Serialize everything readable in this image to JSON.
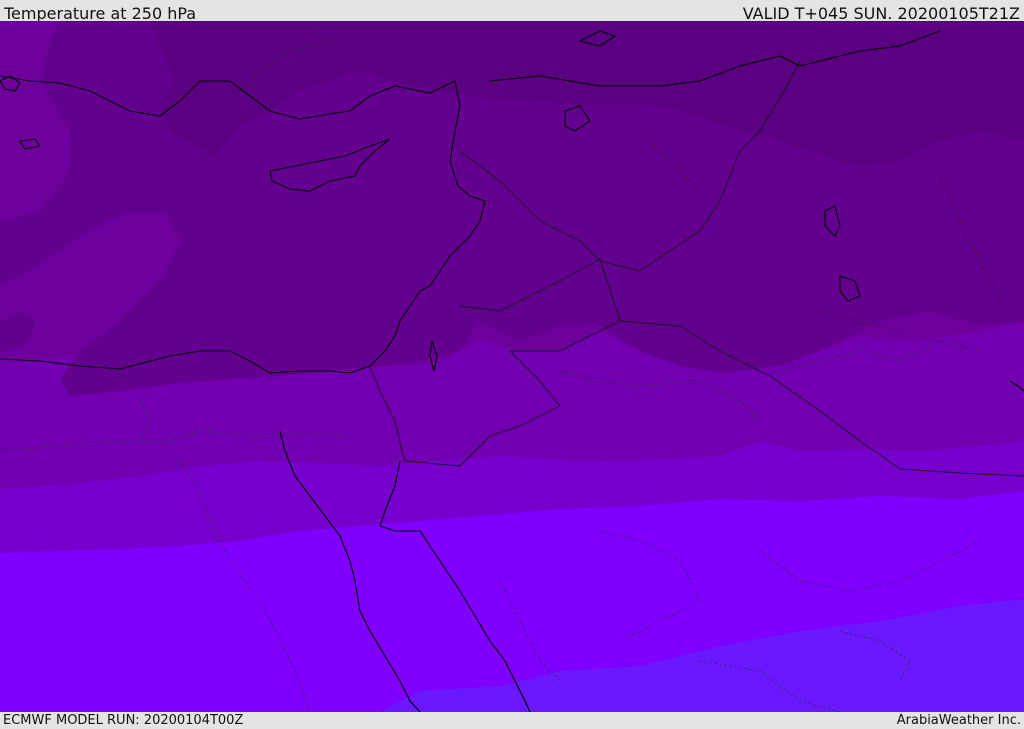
{
  "header": {
    "title": "Temperature at 250 hPa",
    "valid": "VALID T+045 SUN. 20200105T21Z"
  },
  "footer": {
    "model_run": "ECMWF MODEL RUN: 20200104T00Z",
    "credit": "ArabiaWeather Inc."
  },
  "map": {
    "field": "temperature",
    "level": "250 hPa",
    "colors": {
      "darkest": "#5a0080",
      "dark": "#64008f",
      "mid_dark": "#6d009c",
      "mid": "#7100b0",
      "mid_light": "#7600cc",
      "bright": "#7f00ff",
      "blue_violet": "#6a18ff",
      "coast_line": "#000000",
      "border_line": "#1a1a1a"
    }
  }
}
